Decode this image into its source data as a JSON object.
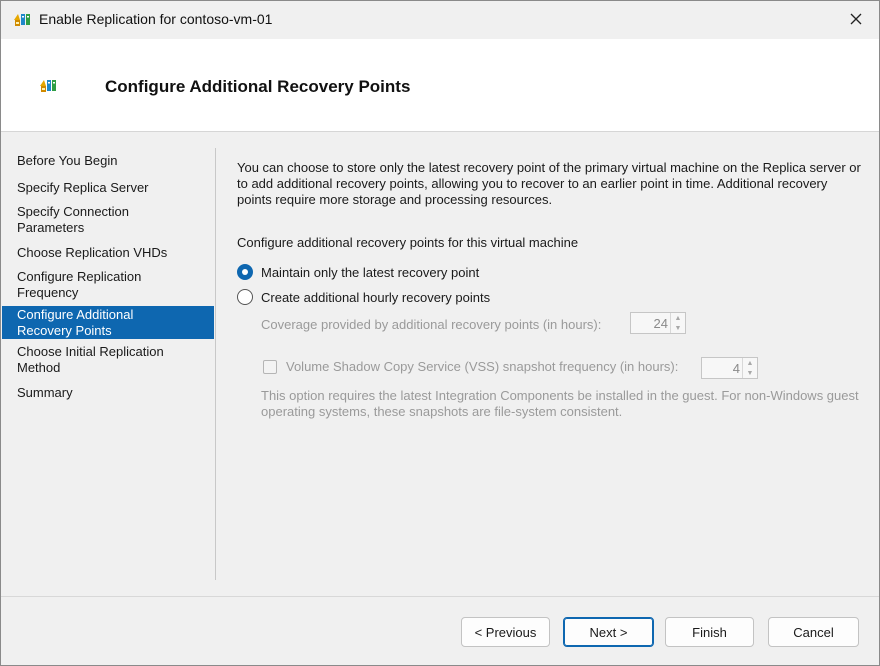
{
  "window": {
    "title": "Enable Replication for contoso-vm-01",
    "icon": "hyperv-replica-icon",
    "close_icon": "close-icon"
  },
  "header": {
    "title": "Configure Additional Recovery Points",
    "icon": "hyperv-replica-icon"
  },
  "nav": {
    "items": [
      {
        "label": "Before You Begin",
        "active": false
      },
      {
        "label": "Specify Replica Server",
        "active": false
      },
      {
        "label": "Specify Connection Parameters",
        "active": false
      },
      {
        "label": "Choose Replication VHDs",
        "active": false
      },
      {
        "label": "Configure Replication Frequency",
        "active": false
      },
      {
        "label": "Configure Additional Recovery Points",
        "active": true
      },
      {
        "label": "Choose Initial Replication Method",
        "active": false
      },
      {
        "label": "Summary",
        "active": false
      }
    ]
  },
  "main": {
    "description": "You can choose to store only the latest recovery point of the primary virtual machine on the Replica server or to add additional recovery points, allowing you to recover to an earlier point in time. Additional recovery points require more storage and processing resources.",
    "subheading": "Configure additional recovery points for this virtual machine",
    "option_latest": "Maintain only the latest recovery point",
    "option_hourly": "Create additional hourly recovery points",
    "selected_option": "latest",
    "coverage_label": "Coverage provided by additional recovery points (in hours):",
    "coverage_value": "24",
    "vss_label": "Volume Shadow Copy Service (VSS) snapshot frequency (in hours):",
    "vss_checked": false,
    "vss_value": "4",
    "note": "This option requires the latest Integration Components be installed in the guest. For non-Windows guest operating systems, these snapshots are file-system consistent."
  },
  "footer": {
    "previous_label": "< Previous",
    "next_label": "Next >",
    "finish_label": "Finish",
    "cancel_label": "Cancel"
  },
  "colors": {
    "accent": "#0e67b0",
    "disabled_text": "#9a9a9a"
  }
}
